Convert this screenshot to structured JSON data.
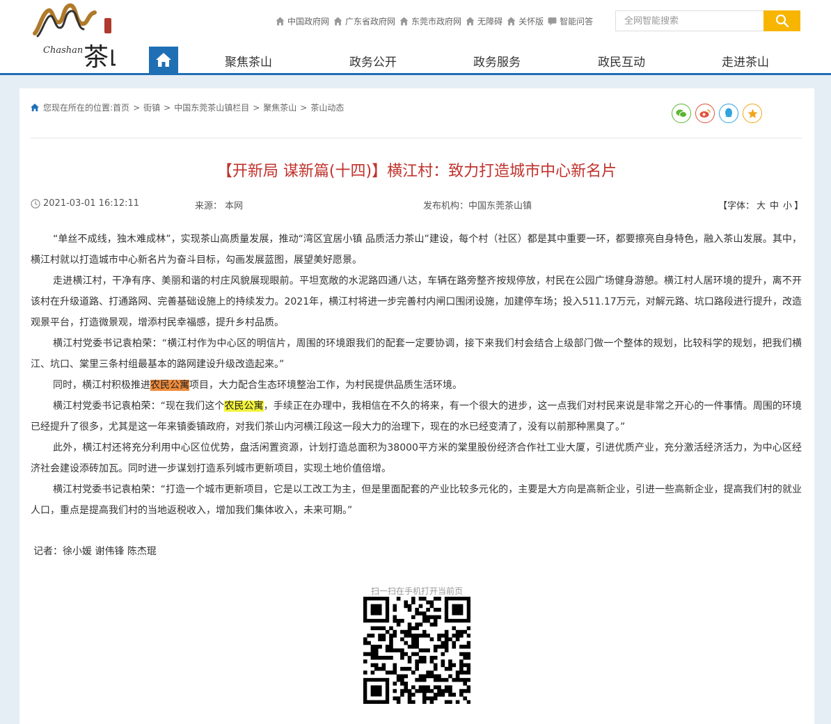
{
  "header": {
    "logo_text_en": "Chashan",
    "logo_text_cn": "茶山",
    "top_links": [
      {
        "label": "中国政府网",
        "icon": "home-icon"
      },
      {
        "label": "广东省政府网",
        "icon": "home-icon"
      },
      {
        "label": "东莞市政府网",
        "icon": "home-icon"
      },
      {
        "label": "无障碍",
        "icon": "home-icon"
      },
      {
        "label": "关怀版",
        "icon": "home-icon"
      },
      {
        "label": "智能问答",
        "icon": "chat-icon"
      }
    ],
    "search": {
      "placeholder": "全网智能搜索"
    },
    "nav": [
      {
        "label": "聚焦茶山"
      },
      {
        "label": "政务公开"
      },
      {
        "label": "政务服务"
      },
      {
        "label": "政民互动"
      },
      {
        "label": "走进茶山"
      }
    ]
  },
  "breadcrumb": {
    "prefix": "您现在所在的位置:",
    "items": [
      "首页",
      "街镇",
      "中国东莞茶山镇栏目",
      "聚焦茶山",
      "茶山动态"
    ],
    "sep": ">"
  },
  "share": [
    "wechat-icon",
    "weibo-icon",
    "qq-icon",
    "favorite-icon"
  ],
  "article": {
    "title": "【开新局 谋新篇(十四)】横江村：致力打造城市中心新名片",
    "datetime": "2021-03-01 16:12:11",
    "source": "来源：  本网",
    "publisher": "发布机构：中国东莞茶山镇",
    "fontsize": {
      "open": "【字体：",
      "large": "大",
      "medium": "中",
      "small": "小",
      "close": "】"
    },
    "p1": "“单丝不成线，独木难成林”，实现茶山高质量发展，推动“湾区宜居小镇 品质活力茶山”建设，每个村（社区）都是其中重要一环，都要擦亮自身特色，融入茶山发展。其中，横江村就以打造城市中心新名片为奋斗目标，勾画发展蓝图，展望美好愿景。",
    "p2": "走进横江村，干净有序、美丽和谐的村庄风貌展现眼前。平坦宽敞的水泥路四通八达，车辆在路旁整齐按规停放，村民在公园广场健身游憩。横江村人居环境的提升，离不开该村在升级道路、打通路网、完善基础设施上的持续发力。2021年，横江村将进一步完善村内闸口围闭设施，加建停车场；投入511.17万元，对解元路、坑口路段进行提升，改造观景平台，打造微景观，增添村民幸福感，提升乡村品质。",
    "p3": "横江村党委书记袁柏荣：“横江村作为中心区的明信片，周围的环境跟我们的配套一定要协调，接下来我们村会结合上级部门做一个整体的规划，比较科学的规划，把我们横江、坑口、棠里三条村组最基本的路网建设升级改造起来。”",
    "p4_a": "同时，横江村积极推进",
    "p4_hl": "农民公寓",
    "p4_b": "项目，大力配合生态环境整治工作，为村民提供品质生活环境。",
    "p5_a": "横江村党委书记袁柏荣：“现在我们这个",
    "p5_hl": "农民公寓",
    "p5_b": "，手续正在办理中，我相信在不久的将来，有一个很大的进步，这一点我们对村民来说是非常之开心的一件事情。周围的环境已经提升了很多，尤其是这一年来镇委镇政府，对我们茶山内河横江段这一段大力的治理下，现在的水已经变清了，没有以前那种黑臭了。”",
    "p6": "此外，横江村还将充分利用中心区位优势，盘活闲置资源，计划打造总面积为38000平方米的棠里股份经济合作社工业大厦，引进优质产业，充分激活经济活力，为中心区经济社会建设添砖加瓦。同时进一步谋划打造系列城市更新项目，实现土地价值倍增。",
    "p7": "横江村党委书记袁柏荣：“打造一个城市更新项目，它是以工改工为主，但是里面配套的产业比较多元化的，主要是大方向是高新企业，引进一些高新企业，提高我们村的就业人口，重点是提高我们村的当地返税收入，增加我们集体收入，未来可期。”",
    "reporter": "记者：徐小媛 谢伟锋 陈杰琨",
    "qr_caption": "扫一扫在手机打开当前页"
  },
  "colors": {
    "brand_blue": "#1f6fb5",
    "title_red": "#c0322c",
    "search_yellow": "#f7b500"
  }
}
